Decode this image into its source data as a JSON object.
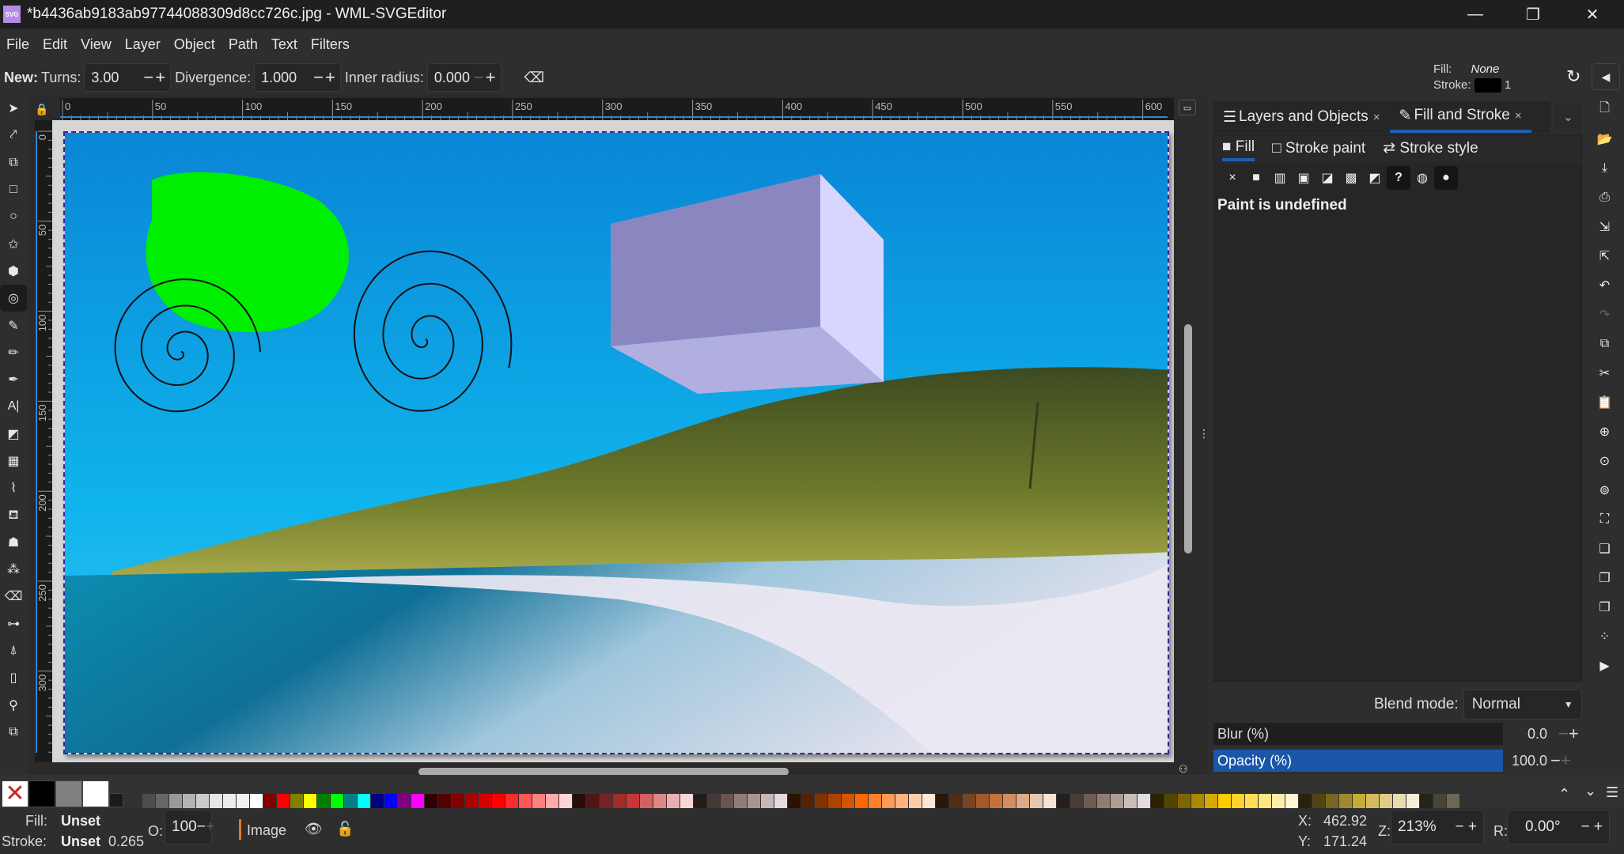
{
  "window": {
    "app_icon": "SVG",
    "title": "*b4436ab9183ab97744088309d8cc726c.jpg - WML-SVGEditor",
    "minimize": "—",
    "maximize": "❐",
    "close": "✕"
  },
  "menu": [
    "File",
    "Edit",
    "View",
    "Layer",
    "Object",
    "Path",
    "Text",
    "Filters"
  ],
  "tool_controls": {
    "mode_label": "New:",
    "turns_label": "Turns:",
    "turns_value": "3.00",
    "divergence_label": "Divergence:",
    "divergence_value": "1.000",
    "inner_radius_label": "Inner radius:",
    "inner_radius_value": "0.000",
    "minus": "−",
    "plus": "+",
    "reset_icon": "⌫"
  },
  "style_indicator": {
    "fill_label": "Fill:",
    "fill_value": "None",
    "stroke_label": "Stroke:",
    "stroke_width": "1",
    "stroke_color": "#000000"
  },
  "toolbox": [
    {
      "name": "selector-tool",
      "glyph": "➤"
    },
    {
      "name": "node-tool",
      "glyph": "⤤"
    },
    {
      "name": "shape-builder-tool",
      "glyph": "⧉"
    },
    {
      "name": "rectangle-tool",
      "glyph": "□"
    },
    {
      "name": "ellipse-tool",
      "glyph": "○"
    },
    {
      "name": "star-tool",
      "glyph": "✩"
    },
    {
      "name": "3d-box-tool",
      "glyph": "⬢"
    },
    {
      "name": "spiral-tool",
      "glyph": "◎",
      "active": true
    },
    {
      "name": "bezier-tool",
      "glyph": "✎"
    },
    {
      "name": "pencil-tool",
      "glyph": "✏"
    },
    {
      "name": "calligraphy-tool",
      "glyph": "✒"
    },
    {
      "name": "text-tool",
      "glyph": "A|"
    },
    {
      "name": "gradient-tool",
      "glyph": "◩"
    },
    {
      "name": "mesh-tool",
      "glyph": "▦"
    },
    {
      "name": "dropper-tool",
      "glyph": "⌇"
    },
    {
      "name": "paint-bucket-tool",
      "glyph": "⛾"
    },
    {
      "name": "tweak-tool",
      "glyph": "☗"
    },
    {
      "name": "spray-tool",
      "glyph": "⁂"
    },
    {
      "name": "eraser-tool",
      "glyph": "⌫"
    },
    {
      "name": "connector-tool",
      "glyph": "⊶"
    },
    {
      "name": "measure-tool",
      "glyph": "⍋"
    },
    {
      "name": "pages-tool",
      "glyph": "▯"
    },
    {
      "name": "zoom-tool",
      "glyph": "⚲"
    },
    {
      "name": "clone-tool",
      "glyph": "⧉"
    }
  ],
  "rulers": {
    "horizontal": [
      "0",
      "50",
      "100",
      "150",
      "200",
      "250",
      "300",
      "350",
      "400",
      "450",
      "500",
      "550",
      "600"
    ],
    "vertical": [
      "0",
      "50",
      "100",
      "150",
      "200",
      "250",
      "300"
    ]
  },
  "canvas": {
    "description": "beach photo with green blob, two black spirals, lavender 3D box",
    "blob_color": "#00ee00",
    "box_front": "#8a87c0",
    "box_side": "#d8d6ff",
    "box_bottom": "#b0afe0",
    "spiral_color": "#111111"
  },
  "dock": {
    "tabs": [
      {
        "icon": "☰",
        "label": "Layers and Objects",
        "close": "×"
      },
      {
        "icon": "✎",
        "label": "Fill and Stroke",
        "close": "×",
        "active": true
      }
    ],
    "menu_icon": "⌄",
    "fill_stroke": {
      "subtabs": [
        {
          "icon": "■",
          "label": "Fill",
          "active": true
        },
        {
          "icon": "□",
          "label": "Stroke paint"
        },
        {
          "icon": "⇄",
          "label": "Stroke style"
        }
      ],
      "paint_buttons": [
        {
          "name": "no-paint",
          "glyph": "×"
        },
        {
          "name": "flat-color",
          "glyph": "■"
        },
        {
          "name": "linear-gradient",
          "glyph": "▥"
        },
        {
          "name": "radial-gradient",
          "glyph": "▣"
        },
        {
          "name": "mesh-gradient",
          "glyph": "◪"
        },
        {
          "name": "pattern",
          "glyph": "▩"
        },
        {
          "name": "swatch",
          "glyph": "◩"
        },
        {
          "name": "unset-paint",
          "glyph": "?",
          "selected": true
        },
        {
          "name": "fill-rule-evenodd",
          "glyph": "◍"
        },
        {
          "name": "fill-rule-nonzero",
          "glyph": "●",
          "selected": true
        }
      ],
      "message": "Paint is undefined",
      "blend_label": "Blend mode:",
      "blend_value": "Normal",
      "blur_label": "Blur (%)",
      "blur_value": "0.0",
      "opacity_label": "Opacity (%)",
      "opacity_value": "100.0",
      "opacity_fraction": 1.0
    }
  },
  "commands": [
    {
      "name": "new-document",
      "glyph": "🗋"
    },
    {
      "name": "open-file",
      "glyph": "📂"
    },
    {
      "name": "save",
      "glyph": "⤓"
    },
    {
      "name": "print",
      "glyph": "⎙"
    },
    {
      "name": "import",
      "glyph": "⇲"
    },
    {
      "name": "export",
      "glyph": "⇱"
    },
    {
      "name": "undo",
      "glyph": "↶"
    },
    {
      "name": "redo",
      "glyph": "↷",
      "dim": true
    },
    {
      "name": "copy",
      "glyph": "⧉"
    },
    {
      "name": "cut",
      "glyph": "✂"
    },
    {
      "name": "paste",
      "glyph": "📋"
    },
    {
      "name": "zoom-selection",
      "glyph": "⊕"
    },
    {
      "name": "zoom-drawing",
      "glyph": "⊙"
    },
    {
      "name": "zoom-page",
      "glyph": "⊚"
    },
    {
      "name": "zoom-page-width",
      "glyph": "⛶"
    },
    {
      "name": "duplicate",
      "glyph": "❏"
    },
    {
      "name": "clone",
      "glyph": "❐"
    },
    {
      "name": "unlink-clone",
      "glyph": "❐"
    },
    {
      "name": "select-same",
      "glyph": "⁘"
    },
    {
      "name": "more",
      "glyph": "▶"
    }
  ],
  "palette": {
    "none_icon": "✕",
    "big": [
      "#000000",
      "#808080",
      "#ffffff",
      "#1a1a1a"
    ],
    "swatches": [
      "#4d4d4d",
      "#666666",
      "#999999",
      "#b3b3b3",
      "#cccccc",
      "#e6e6e6",
      "#ececec",
      "#f2f2f2",
      "#ffffff",
      "#800000",
      "#ff0000",
      "#808000",
      "#ffff00",
      "#008000",
      "#00ff00",
      "#008080",
      "#00ffff",
      "#000080",
      "#0000ff",
      "#800080",
      "#ff00ff",
      "#2b0000",
      "#550000",
      "#800000",
      "#aa0000",
      "#d40000",
      "#ff0000",
      "#ff2a2a",
      "#ff5555",
      "#ff8080",
      "#ffaaaa",
      "#ffd5d5",
      "#280b0b",
      "#501616",
      "#782121",
      "#a02c2c",
      "#c83737",
      "#d35f5f",
      "#de8787",
      "#e9afaf",
      "#f4d7d7",
      "#241c1c",
      "#483737",
      "#6c5353",
      "#917c7c",
      "#ac9393",
      "#c8b7b7",
      "#e3dbdb",
      "#2b1100",
      "#552200",
      "#803300",
      "#aa4400",
      "#d45500",
      "#ff6600",
      "#ff7f2a",
      "#ff9955",
      "#ffb380",
      "#ffccaa",
      "#ffe6d5",
      "#28170b",
      "#502d16",
      "#784421",
      "#a05a2c",
      "#c87137",
      "#d38d5f",
      "#deaa87",
      "#e9c6af",
      "#f4e3d7",
      "#241f1c",
      "#483e37",
      "#6c5d53",
      "#917c6f",
      "#ac9d93",
      "#c8beb7",
      "#e3dedb",
      "#2b2200",
      "#554400",
      "#806600",
      "#aa8800",
      "#d4aa00",
      "#ffcc00",
      "#ffd42a",
      "#ffdd55",
      "#ffe680",
      "#ffeeaa",
      "#fff6d5",
      "#28220b",
      "#504416",
      "#786721",
      "#a0892c",
      "#c8ab37",
      "#d3bc5f",
      "#decd87",
      "#e9ddaf",
      "#f4eed7",
      "#24221c",
      "#484537",
      "#6c6753"
    ],
    "scroll_up": "⌃",
    "scroll_down": "⌄",
    "menu": "☰"
  },
  "status": {
    "fill_label": "Fill:",
    "fill_value": "Unset",
    "stroke_label": "Stroke:",
    "stroke_value": "Unset",
    "stroke_width": "0.265",
    "opacity_label": "O:",
    "opacity_value": "100",
    "layer_name": "Image",
    "visibility_icon": "👁",
    "lock_icon": "🔓",
    "x_label": "X:",
    "x_value": "462.92",
    "y_label": "Y:",
    "y_value": "171.24",
    "zoom_label": "Z:",
    "zoom_value": "213%",
    "rotate_label": "R:",
    "rotate_value": "0.00°"
  }
}
